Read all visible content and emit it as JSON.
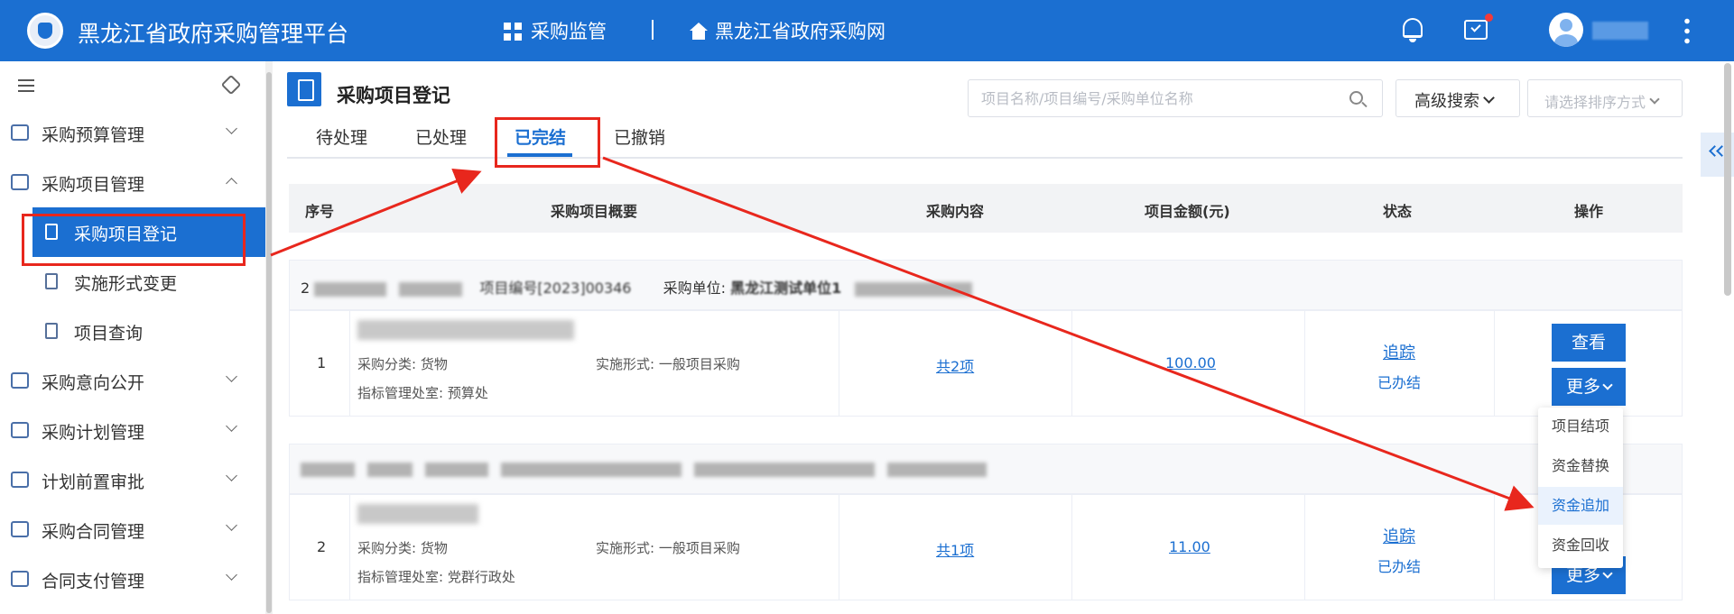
{
  "header": {
    "app_title": "黑龙江省政府采购管理平台",
    "nav": [
      {
        "label": "采购监管",
        "icon": "grid-icon"
      },
      {
        "label": "黑龙江省政府采购网",
        "icon": "home-icon"
      }
    ],
    "icons": [
      "bell-icon",
      "todo-icon",
      "avatar",
      "more-vertical-icon"
    ],
    "notification_dot_color": "#f23a3a"
  },
  "sidebar": {
    "items": [
      {
        "label": "采购预算管理",
        "icon": "chart-icon",
        "expanded": false
      },
      {
        "label": "采购项目管理",
        "icon": "folder-icon",
        "expanded": true,
        "children": [
          {
            "label": "采购项目登记",
            "icon": "document-icon",
            "active": true
          },
          {
            "label": "实施形式变更",
            "icon": "edit-document-icon"
          },
          {
            "label": "项目查询",
            "icon": "search-document-icon"
          }
        ]
      },
      {
        "label": "采购意向公开",
        "icon": "notice-icon",
        "expanded": false
      },
      {
        "label": "采购计划管理",
        "icon": "calendar-icon",
        "expanded": false
      },
      {
        "label": "计划前置审批",
        "icon": "approval-icon",
        "expanded": false
      },
      {
        "label": "采购合同管理",
        "icon": "contract-icon",
        "expanded": false
      },
      {
        "label": "合同支付管理",
        "icon": "payment-icon",
        "expanded": false
      }
    ]
  },
  "page": {
    "title": "采购项目登记",
    "search_placeholder": "项目名称/项目编号/采购单位名称",
    "advanced_search": "高级搜索",
    "sort_placeholder": "请选择排序方式",
    "tabs": [
      {
        "label": "待处理",
        "active": false
      },
      {
        "label": "已处理",
        "active": false
      },
      {
        "label": "已完结",
        "active": true
      },
      {
        "label": "已撤销",
        "active": false
      }
    ],
    "accent_color": "#1b6fd1",
    "annotation_color": "#e8271d"
  },
  "table": {
    "columns": [
      "序号",
      "采购项目概要",
      "采购内容",
      "项目金额(元)",
      "状态",
      "操作"
    ],
    "groups": [
      {
        "header_prefix": "2",
        "header_fragment": "项目编号[2023]00346",
        "unit_label": "采购单位:",
        "unit_value": "黑龙江测试单位1",
        "row": {
          "index": "1",
          "category_label": "采购分类:",
          "category": "货物",
          "form_label": "实施形式:",
          "form": "一般项目采购",
          "office_label": "指标管理处室:",
          "office": "预算处",
          "content_link": "共2项",
          "amount": "100.00",
          "track": "追踪",
          "status": "已办结",
          "view": "查看",
          "more": "更多"
        }
      },
      {
        "header_prefix": "",
        "header_fragment": "",
        "unit_label": "",
        "unit_value": "",
        "row": {
          "index": "2",
          "category_label": "采购分类:",
          "category": "货物",
          "form_label": "实施形式:",
          "form": "一般项目采购",
          "office_label": "指标管理处室:",
          "office": "党群行政处",
          "content_link": "共1项",
          "amount": "11.00",
          "track": "追踪",
          "status": "已办结",
          "more": "更多"
        }
      }
    ]
  },
  "more_menu": {
    "items": [
      "项目结项",
      "资金替换",
      "资金追加",
      "资金回收"
    ],
    "highlighted": "资金追加"
  }
}
